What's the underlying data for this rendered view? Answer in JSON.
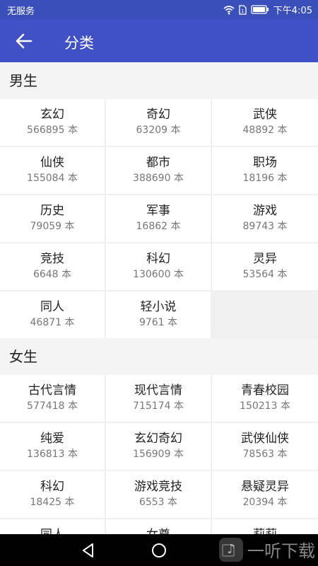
{
  "status_bar": {
    "carrier": "无服务",
    "time": "下午4:05",
    "icons": [
      "wifi-icon",
      "sim-icon",
      "battery-icon"
    ]
  },
  "app_bar": {
    "back_icon": "arrow-left-icon",
    "title": "分类"
  },
  "sections": [
    {
      "title": "男生",
      "items": [
        {
          "name": "玄幻",
          "count": "566895 本"
        },
        {
          "name": "奇幻",
          "count": "63209 本"
        },
        {
          "name": "武侠",
          "count": "48892 本"
        },
        {
          "name": "仙侠",
          "count": "155084 本"
        },
        {
          "name": "都市",
          "count": "388690 本"
        },
        {
          "name": "职场",
          "count": "18196 本"
        },
        {
          "name": "历史",
          "count": "79059 本"
        },
        {
          "name": "军事",
          "count": "16862 本"
        },
        {
          "name": "游戏",
          "count": "89743 本"
        },
        {
          "name": "竞技",
          "count": "6648 本"
        },
        {
          "name": "科幻",
          "count": "130600 本"
        },
        {
          "name": "灵异",
          "count": "53564 本"
        },
        {
          "name": "同人",
          "count": "46871 本"
        },
        {
          "name": "轻小说",
          "count": "9761 本"
        }
      ]
    },
    {
      "title": "女生",
      "items": [
        {
          "name": "古代言情",
          "count": "577418 本"
        },
        {
          "name": "现代言情",
          "count": "715174 本"
        },
        {
          "name": "青春校园",
          "count": "150213 本"
        },
        {
          "name": "纯爱",
          "count": "136813 本"
        },
        {
          "name": "玄幻奇幻",
          "count": "156909 本"
        },
        {
          "name": "武侠仙侠",
          "count": "78563 本"
        },
        {
          "name": "科幻",
          "count": "18425 本"
        },
        {
          "name": "游戏竞技",
          "count": "6553 本"
        },
        {
          "name": "悬疑灵异",
          "count": "20394 本"
        },
        {
          "name": "同人",
          "count": ""
        },
        {
          "name": "女尊",
          "count": ""
        },
        {
          "name": "莉莉",
          "count": ""
        }
      ]
    }
  ],
  "nav_bar": {
    "icons": [
      "back-triangle-icon",
      "home-circle-icon",
      "recents-square-icon"
    ]
  },
  "watermark": {
    "text": "一听下载"
  },
  "colors": {
    "status_bar": "#3a4fb9",
    "app_bar": "#3f51c4",
    "background": "#f0f0f0",
    "cell": "#ffffff"
  }
}
